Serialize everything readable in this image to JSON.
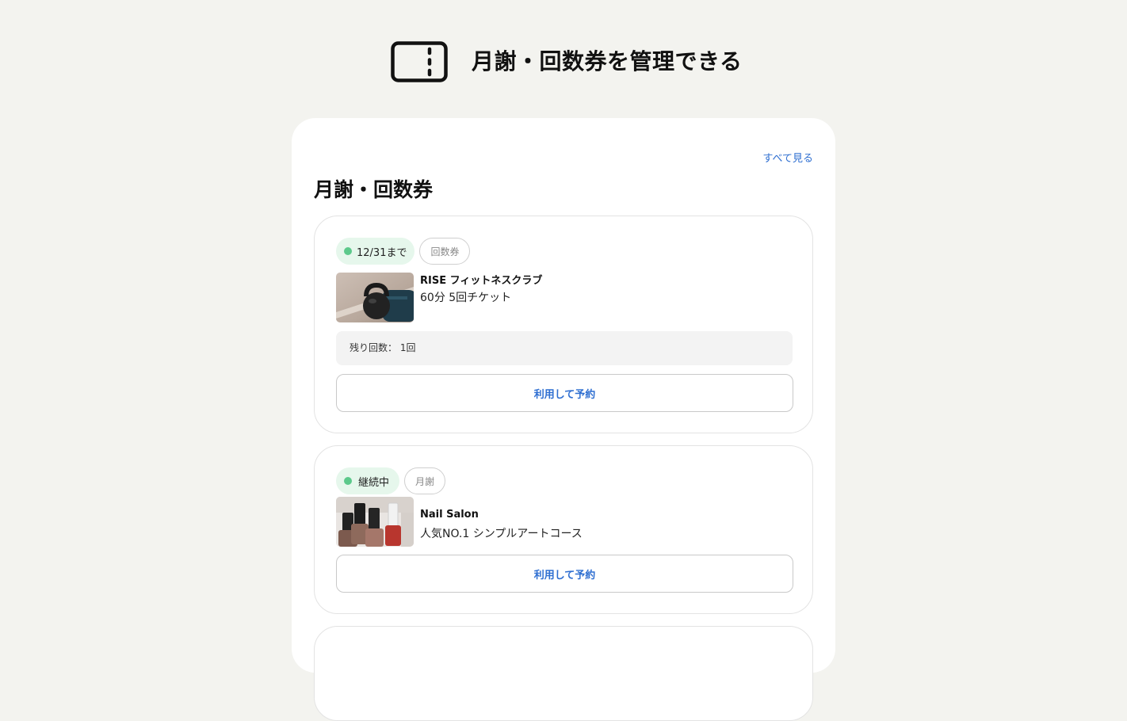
{
  "header": {
    "icon": "ticket-icon",
    "title": "月謝・回数券を管理できる"
  },
  "panel": {
    "see_all_link": "すべて見る",
    "section_title": "月謝・回数券",
    "cards": [
      {
        "status_label": "12/31まで",
        "status_color": "#5cc98b",
        "type_label": "回数券",
        "thumbnail": "kettlebell-photo",
        "shop_name": "RISE フィットネスクラブ",
        "plan_name": "60分 5回チケット",
        "remaining_text": "残り回数：  1回",
        "action_label": "利用して予約"
      },
      {
        "status_label": "継続中",
        "status_color": "#5cc98b",
        "type_label": "月謝",
        "thumbnail": "nail-polish-photo",
        "shop_name": "Nail Salon",
        "plan_name": "人気NO.1 シンプルアートコース",
        "action_label": "利用して予約"
      }
    ]
  },
  "colors": {
    "background": "#f3f3ef",
    "accent_link": "#2f6fd1",
    "status_green": "#5cc98b",
    "status_bg": "#e6f7ec"
  }
}
